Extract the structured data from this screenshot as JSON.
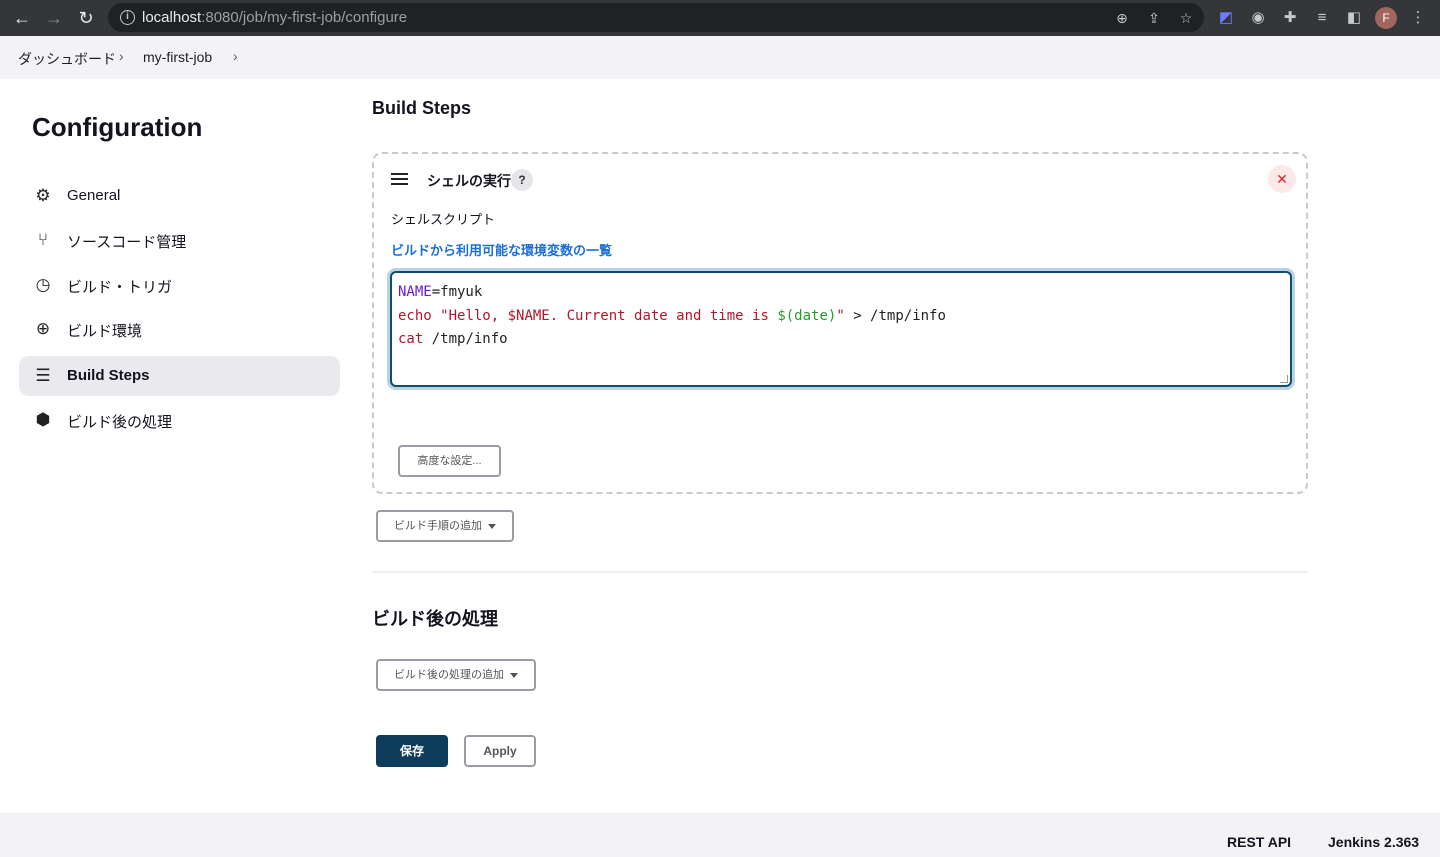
{
  "browser": {
    "url_host": "localhost",
    "url_path": ":8080/job/my-first-job/configure",
    "profile_initial": "F"
  },
  "breadcrumb": [
    "ダッシュボード",
    "my-first-job"
  ],
  "sidebar": {
    "title": "Configuration",
    "items": [
      {
        "label": "General",
        "icon": "gear-icon"
      },
      {
        "label": "ソースコード管理",
        "icon": "branch-icon"
      },
      {
        "label": "ビルド・トリガ",
        "icon": "timer-icon"
      },
      {
        "label": "ビルド環境",
        "icon": "globe-icon"
      },
      {
        "label": "Build Steps",
        "icon": "list-icon",
        "active": true
      },
      {
        "label": "ビルド後の処理",
        "icon": "package-icon"
      }
    ]
  },
  "build_steps": {
    "title": "Build Steps",
    "step": {
      "title": "シェルの実行",
      "help": "?",
      "field_label": "シェルスクリプト",
      "env_link": "ビルドから利用可能な環境変数の一覧",
      "script": {
        "line1_var": "NAME",
        "line1_rest": "=fmyuk",
        "line2_cmd": "echo",
        "line2_str": "\"Hello, $NAME. Current date and time is ",
        "line2_sub": "$(date)",
        "line2_end": "\"",
        "line2_rest": " > /tmp/info",
        "line3_cmd": "cat",
        "line3_rest": " /tmp/info"
      },
      "advanced_button": "高度な設定..."
    },
    "add_step_button": "ビルド手順の追加"
  },
  "post_build": {
    "title": "ビルド後の処理",
    "add_button": "ビルド後の処理の追加"
  },
  "actions": {
    "save": "保存",
    "apply": "Apply"
  },
  "footer": {
    "rest_api": "REST API",
    "version": "Jenkins 2.363"
  },
  "colors": {
    "primary": "#0e3d5c",
    "link": "#1a6fd6",
    "danger": "#d22222"
  }
}
